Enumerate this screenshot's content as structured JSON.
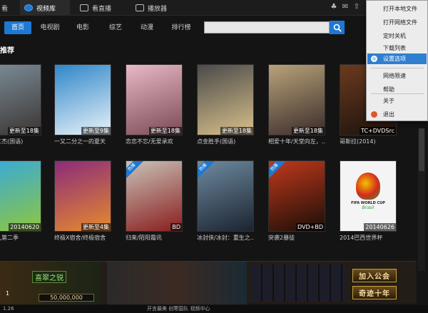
{
  "top_tabs": [
    "看",
    "视频库",
    "看直播",
    "播放器"
  ],
  "nav": {
    "items": [
      "首页",
      "电视剧",
      "电影",
      "综艺",
      "动漫",
      "排行榜"
    ],
    "search_placeholder": ""
  },
  "section_title": "推荐",
  "corner_label": "热播",
  "row1": [
    {
      "badge": "更新至18集",
      "title": "探狄仁杰(国语)",
      "colors": [
        "#7d8e9a",
        "#3b3531"
      ]
    },
    {
      "badge": "更新至9集",
      "title": "一又二分之一的夏天",
      "colors": [
        "#2f86c9",
        "#e9f3f9"
      ]
    },
    {
      "badge": "更新至18集",
      "title": "恋恋不忘/无爱承欢",
      "colors": [
        "#e8b9c6",
        "#7a4a55"
      ]
    },
    {
      "badge": "更新至18集",
      "title": "点金胜手(国语)",
      "colors": [
        "#4a4a4a",
        "#d8c08a"
      ]
    },
    {
      "badge": "更新至18集",
      "title": "相爱十年/天堂向左，…",
      "colors": [
        "#b9a27a",
        "#3a2c2a"
      ]
    },
    {
      "badge": "TC+DVDSrc",
      "title": "哥斯拉(2014)",
      "colors": [
        "#6b3a1e",
        "#1a120d"
      ]
    }
  ],
  "row2": [
    {
      "badge": "20140620",
      "title": "去哪儿第二季",
      "colors": [
        "#36a9dc",
        "#8ec63f"
      ],
      "corner": false
    },
    {
      "badge": "更新至4集",
      "title": "终极X宿舍/终极宿舍",
      "colors": [
        "#8b2b7a",
        "#e68a2e"
      ],
      "corner": false
    },
    {
      "badge": "BD",
      "title": "归来/陌阳霜讯",
      "colors": [
        "#c8c3b8",
        "#8a1d1d"
      ],
      "corner": true
    },
    {
      "badge": "",
      "title": "冰封侠/冰封：重生之…",
      "colors": [
        "#6e8aa0",
        "#1b2430"
      ],
      "corner": true
    },
    {
      "badge": "DVD+BD",
      "title": "突袭2暴徒",
      "colors": [
        "#c0391b",
        "#1a0e08"
      ],
      "corner": true
    },
    {
      "badge": "20140626",
      "title": "2014巴西世界杯",
      "colors": [
        "#f4f4f4",
        "#f4f4f4"
      ],
      "corner": false
    }
  ],
  "ad": {
    "label": "喜翠之锐",
    "gold": "50,000,000",
    "join_button": "加入公会",
    "miracle_button": "奇迹十年",
    "level": "1"
  },
  "worldcup_text": "FIFA WORLD CUP",
  "worldcup_sub": "Brasil",
  "status": {
    "left": "1.26",
    "center": "开言最美 创寒国队 视频中心"
  },
  "menu": {
    "items": [
      {
        "label": "打开本地文件",
        "active": false
      },
      {
        "label": "打开网络文件",
        "active": false
      },
      {
        "label": "定时关机",
        "active": false
      },
      {
        "label": "下载列表",
        "active": false
      },
      {
        "label": "设置选项",
        "active": true
      },
      {
        "label": "网络限速",
        "active": false
      },
      {
        "label": "帮助",
        "active": false
      },
      {
        "label": "关于",
        "active": false
      },
      {
        "label": "退出",
        "active": false
      }
    ]
  }
}
